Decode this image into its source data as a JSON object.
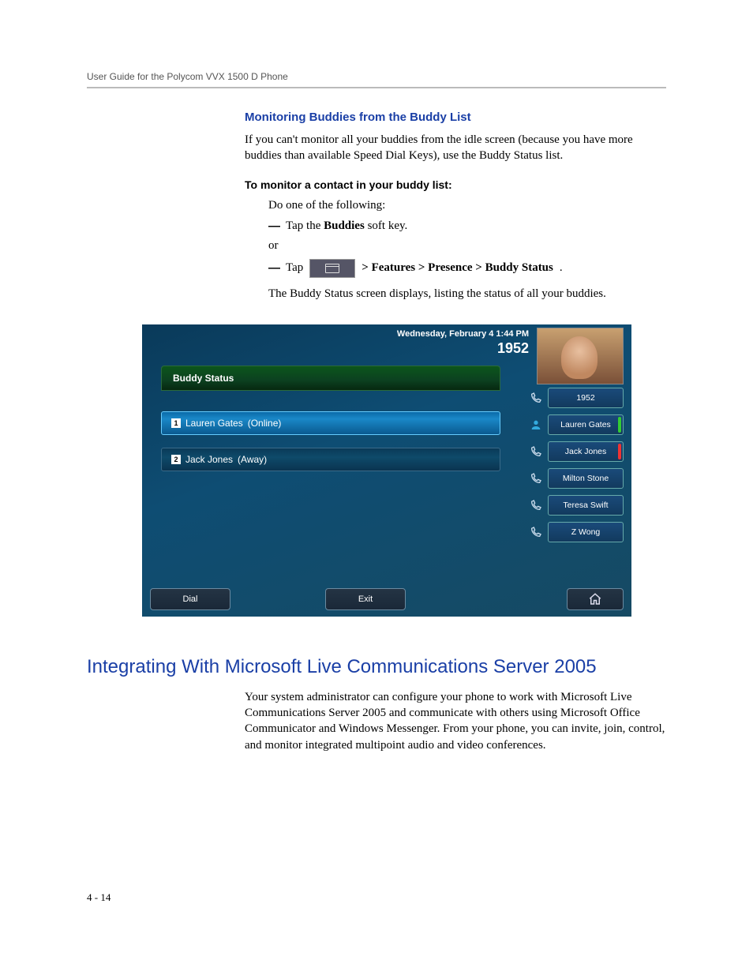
{
  "running_head": "User Guide for the Polycom VVX 1500 D Phone",
  "section": {
    "h3": "Monitoring Buddies from the Buddy List",
    "p1": "If you can't monitor all your buddies from the idle screen (because you have more buddies than available Speed Dial Keys), use the Buddy Status list.",
    "subhead": "To monitor a contact in your buddy list:",
    "do_one": "Do one of the following:",
    "bullet1_pre": "Tap the ",
    "bullet1_bold": "Buddies",
    "bullet1_post": " soft key.",
    "or": "or",
    "bullet2_pre": "Tap ",
    "bullet2_path": " > Features > Presence > Buddy Status",
    "after_img": "The Buddy Status screen displays, listing the status of all your buddies."
  },
  "phone": {
    "datetime": "Wednesday, February 4  1:44 PM",
    "extension": "1952",
    "panel_title": "Buddy Status",
    "buddies": [
      {
        "num": "1",
        "name": "Lauren Gates",
        "status": "(Online)"
      },
      {
        "num": "2",
        "name": "Jack Jones",
        "status": "(Away)"
      }
    ],
    "side": [
      {
        "label": "1952",
        "marker": ""
      },
      {
        "label": "Lauren Gates",
        "marker": "green"
      },
      {
        "label": "Jack Jones",
        "marker": "red"
      },
      {
        "label": "Milton Stone",
        "marker": ""
      },
      {
        "label": "Teresa Swift",
        "marker": ""
      },
      {
        "label": "Z Wong",
        "marker": ""
      }
    ],
    "softkeys": {
      "dial": "Dial",
      "exit": "Exit"
    }
  },
  "h2": "Integrating With Microsoft Live Communications Server 2005",
  "p2": "Your system administrator can configure your phone to work with Microsoft Live Communications Server 2005 and communicate with others using Microsoft Office Communicator and Windows Messenger. From your phone, you can invite, join, control, and monitor integrated multipoint audio and video conferences.",
  "page_num": "4 - 14"
}
